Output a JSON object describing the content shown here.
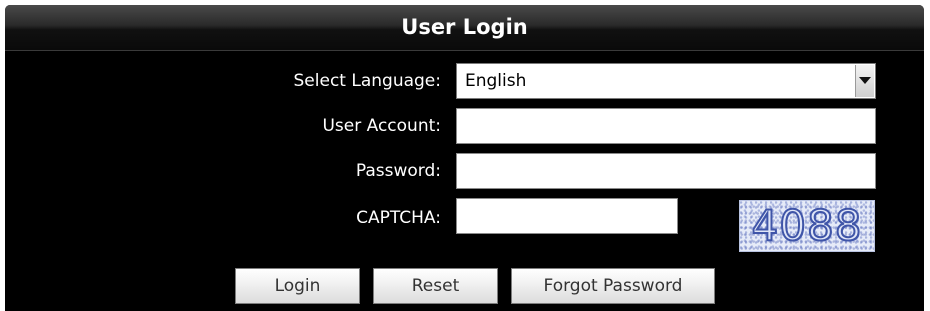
{
  "login": {
    "title": "User Login",
    "language": {
      "label": "Select Language:",
      "selected": "English"
    },
    "account": {
      "label": "User Account:",
      "value": ""
    },
    "password": {
      "label": "Password:",
      "value": ""
    },
    "captcha": {
      "label": "CAPTCHA:",
      "value": "",
      "image_text": "4088"
    },
    "buttons": {
      "login": "Login",
      "reset": "Reset",
      "forgot": "Forgot Password"
    }
  },
  "colors": {
    "panel_background": "#000000",
    "title_text": "#ffffff",
    "label_text": "#ffffff",
    "captcha_digits": "#3f55a8"
  },
  "icons": {
    "dropdown": "chevron-down-icon"
  }
}
